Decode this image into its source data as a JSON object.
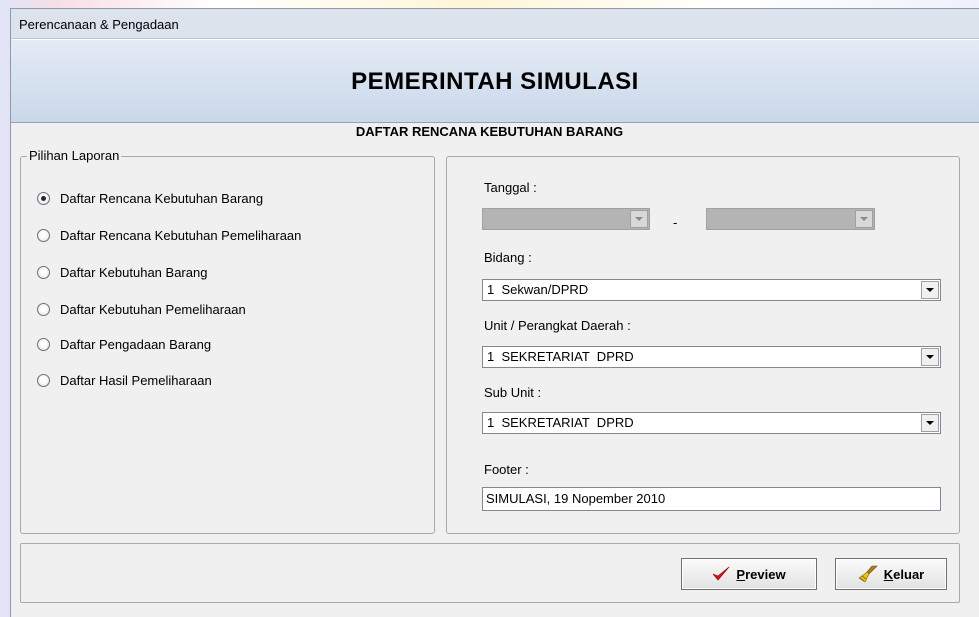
{
  "window": {
    "title": "Perencanaan & Pengadaan"
  },
  "header": {
    "title": "PEMERINTAH SIMULASI"
  },
  "subtitle": "DAFTAR RENCANA KEBUTUHAN BARANG",
  "report_options": {
    "legend": "Pilihan Laporan",
    "selected_index": 0,
    "items": [
      {
        "label": "Daftar Rencana Kebutuhan Barang"
      },
      {
        "label": "Daftar Rencana Kebutuhan Pemeliharaan"
      },
      {
        "label": "Daftar Kebutuhan Barang"
      },
      {
        "label": "Daftar Kebutuhan Pemeliharaan"
      },
      {
        "label": "Daftar Pengadaan Barang"
      },
      {
        "label": "Daftar Hasil Pemeliharaan"
      }
    ]
  },
  "form": {
    "tanggal": {
      "label": "Tanggal :",
      "from_value": "",
      "separator": "-",
      "to_value": ""
    },
    "bidang": {
      "label": "Bidang :",
      "value": "1  Sekwan/DPRD"
    },
    "unit": {
      "label": "Unit / Perangkat Daerah :",
      "value": "1  SEKRETARIAT  DPRD"
    },
    "sub_unit": {
      "label": "Sub Unit :",
      "value": "1  SEKRETARIAT  DPRD"
    },
    "footer": {
      "label": "Footer :",
      "value": "SIMULASI, 19 Nopember 2010"
    }
  },
  "buttons": {
    "preview": {
      "mnemonic": "P",
      "rest": "review",
      "icon": "checkmark-icon",
      "icon_color": "#e01010"
    },
    "keluar": {
      "mnemonic": "K",
      "rest": "eluar",
      "icon": "broom-icon"
    }
  }
}
